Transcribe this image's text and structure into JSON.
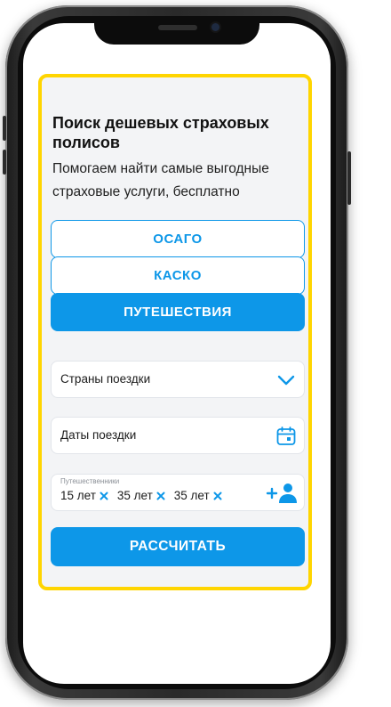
{
  "header": {
    "title": "Поиск дешевых страховых полисов",
    "subtitle": "Помогаем найти самые выгодные страховые услуги, бесплатно"
  },
  "tabs": [
    {
      "label": "ОСАГО",
      "active": false
    },
    {
      "label": "КАСКО",
      "active": false
    },
    {
      "label": "ПУТЕШЕСТВИЯ",
      "active": true
    }
  ],
  "form": {
    "countries_label": "Страны поездки",
    "dates_label": "Даты поездки",
    "travelers_label": "Путешественники",
    "travelers": [
      "15 лет",
      "35 лет",
      "35 лет"
    ]
  },
  "submit_label": "РАССЧИТАТЬ",
  "colors": {
    "accent": "#0d97e8",
    "frame_border": "#ffd500",
    "card_bg": "#f3f4f6"
  },
  "icons": {
    "countries": "chevron-down-icon",
    "dates": "calendar-icon",
    "remove": "close-icon",
    "add_traveler": "add-user-icon"
  }
}
